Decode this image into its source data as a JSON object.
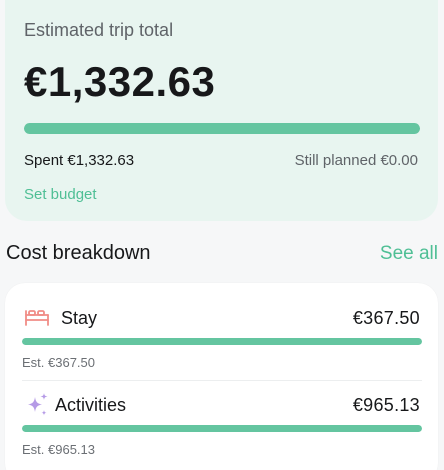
{
  "summary": {
    "title": "Estimated trip total",
    "total": "€1,332.63",
    "spent_fraction": 1.0,
    "spent_label": "Spent €1,332.63",
    "planned_label": "Still planned €0.00",
    "set_budget_label": "Set budget"
  },
  "breakdown": {
    "title": "Cost breakdown",
    "see_all_label": "See all",
    "items": [
      {
        "name": "Stay",
        "icon": "bed-icon",
        "amount": "€367.50",
        "estimate": "Est. €367.50",
        "fraction": 1.0
      },
      {
        "name": "Activities",
        "icon": "sparkles-icon",
        "amount": "€965.13",
        "estimate": "Est. €965.13",
        "fraction": 1.0
      }
    ]
  },
  "colors": {
    "accent": "#64c5a0",
    "link": "#4fbf95",
    "summary_bg": "#e8f5f0",
    "stay_icon": "#f08c86",
    "activities_icon": "#b59ae6"
  }
}
